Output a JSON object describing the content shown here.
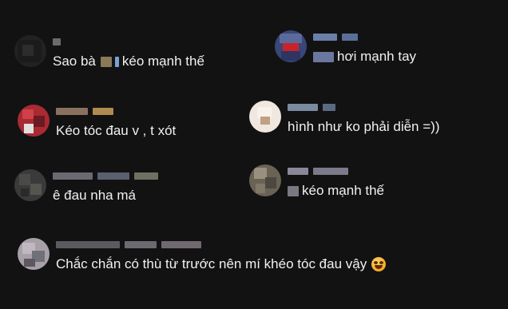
{
  "comments": [
    {
      "id": "c1",
      "text": "Sao bà",
      "text_after": "kéo mạnh thế",
      "avatar_colors": [
        "#2a2a2a",
        "#1e1e1e",
        "#333333",
        "#262626"
      ],
      "name_colors": [
        "#6b6b6b"
      ]
    },
    {
      "id": "c2",
      "text": "hơi mạnh tay",
      "avatar_colors": [
        "#4a5a8a",
        "#c8232d",
        "#2d3560",
        "#8890b0"
      ],
      "name_colors": [
        "#6a7fa8",
        "#5a6f98"
      ]
    },
    {
      "id": "c3",
      "text": "Kéo tóc đau v , t xót",
      "avatar_colors": [
        "#b8323a",
        "#8a2028",
        "#d04048",
        "#6a1a20"
      ],
      "name_colors": [
        "#8a7060",
        "#b08a50"
      ]
    },
    {
      "id": "c4",
      "text": "hình như ko phải diễn =))",
      "avatar_colors": [
        "#e8e0d8",
        "#f4ecdf",
        "#c0a080",
        "#f8f0e8"
      ],
      "name_colors": [
        "#7a8aa0",
        "#5a6a80"
      ]
    },
    {
      "id": "c5",
      "text": "ê đau nha má",
      "avatar_colors": [
        "#3a3a3a",
        "#4a4a48",
        "#2a2a2a",
        "#555550"
      ],
      "name_colors": [
        "#6a6a70",
        "#5a6070",
        "#707060"
      ]
    },
    {
      "id": "c6",
      "text": "kéo mạnh thế",
      "avatar_colors": [
        "#706858",
        "#9a9080",
        "#4a4840",
        "#807868"
      ],
      "name_colors": [
        "#8a8898",
        "#7a7a8a"
      ]
    },
    {
      "id": "c7",
      "text": "Chắc chắn có thù từ trước nên mí khéo tóc đau vậy",
      "emoji": "smiling-face-with-sweat-emoji",
      "avatar_colors": [
        "#b0a8b0",
        "#707078",
        "#c0b8c0",
        "#605860"
      ],
      "name_colors": [
        "#5a5a60",
        "#6a6a70",
        "#706a70"
      ]
    }
  ]
}
